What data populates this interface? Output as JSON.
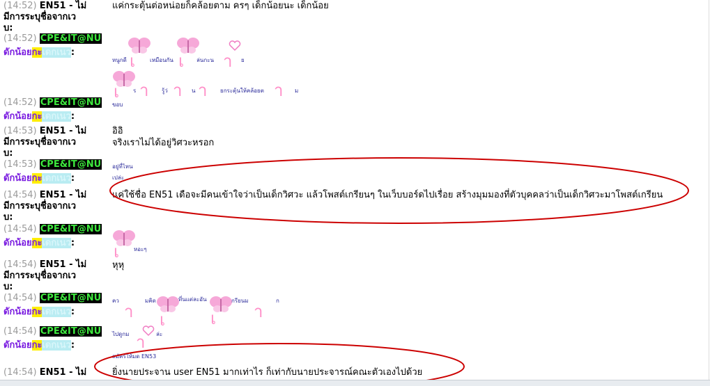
{
  "rows": [
    {
      "time": "(14:52)",
      "nick": "EN51 - ไม่",
      "nick2": "มีการระบุชื่อจากเว",
      "nick3": "บ:",
      "msg": "แค่กระตุ้นต่อหน่อยก็คล้อยตาม ครๆ เด็กน้อยนะ เด็กน้อย"
    },
    {
      "time": "(14:52)",
      "nick": "CPE&IT@NU",
      "line2a": "ดักน้อย",
      "line2b": "กะ",
      "line2c": "เดกเนว",
      "line2d": ":",
      "msg": [
        "หนูกดี",
        "เหมือนกัน",
        "ล่นกะน",
        "ย",
        "ร",
        "รู้ว่",
        "น",
        "ยกระตุ้นให้คล้อยต",
        "ม",
        "ขอบ"
      ]
    },
    {
      "time": "(14:52)",
      "nick": "CPE&IT@NU",
      "line2a": "ดักน้อย",
      "line2b": "กะ",
      "line2c": "เดกเนว",
      "line2d": ":",
      "msg": "ขอบ"
    },
    {
      "time": "(14:53)",
      "nick": "EN51 - ไม่",
      "nick2": "มีการระบุชื่อจากเว",
      "nick3": "บ:",
      "msg": "อิอิ",
      "msg2": "จริงเราไม่ได้อยู่วิศวะหรอก"
    },
    {
      "time": "(14:53)",
      "nick": "CPE&IT@NU",
      "line2a": "ดักน้อย",
      "line2b": "กะ",
      "line2c": "เดกเนว",
      "line2d": ":",
      "msg": "อยู่ที่ไหน",
      "msg2": "เปล่ะ"
    },
    {
      "time": "(14:54)",
      "nick": "EN51 - ไม่",
      "nick2": "มีการระบุชื่อจากเว",
      "nick3": "บ:",
      "msg": "แค่ใช้ชื่อ EN51 เดือจะมีคนเข้าใจว่าเป็นเด็กวิศวะ แล้วโพสต์เกรียนๆ ในเว็บบอร์ดไปเรื่อย สร้างมุมมองที่ตัวบุคคลว่าเป็นเด็กวิศวะมาโพสต์เกรียน"
    },
    {
      "time": "(14:54)",
      "nick": "CPE&IT@NU",
      "line2a": "ดักน้อย",
      "line2b": "กะ",
      "line2c": "เดกเนว",
      "line2d": ":",
      "msg": "หอะๆ"
    },
    {
      "time": "(14:54)",
      "nick": "EN51 - ไม่",
      "nick2": "มีการระบุชื่อจากเว",
      "nick3": "บ:",
      "msg": "หุหุ"
    },
    {
      "time": "(14:54)",
      "nick": "CPE&IT@NU",
      "line2a": "ดักน้อย",
      "line2b": "กะ",
      "line2c": "เดกเนว",
      "line2d": ":",
      "msg": [
        "คว",
        "มคิด",
        "ที่นแต่ละอัน",
        "กรียนม",
        "ก"
      ]
    },
    {
      "time": "(14:54)",
      "nick": "CPE&IT@NU",
      "line2a": "ดักน้อย",
      "line2b": "กะ",
      "line2c": "เดกเนว",
      "line2d": ":",
      "msg": [
        "ไปดูกม",
        "ล่ะ",
        "สมัครให้มด EN53"
      ]
    },
    {
      "time": "(14:54)",
      "nick": "EN51 - ไม่",
      "msg": "ยิ่งนายประจาน user EN51 มากเท่าไร ก็เท่ากับนายประจารณ์คณะตัวเองไปด้วย"
    }
  ],
  "colors": {
    "timestamp": "#9a9a9a",
    "nick_bg": "#000000",
    "nick_fg": "#3ee83e",
    "purple": "#7a1ce0",
    "highlight_yellow": "#ffee00",
    "highlight_cyan": "#b9ecf2",
    "ellipse": "#cc0000",
    "glyph": "#ff8fc8"
  },
  "icons": [
    "butterfly-icon",
    "heart-icon"
  ]
}
